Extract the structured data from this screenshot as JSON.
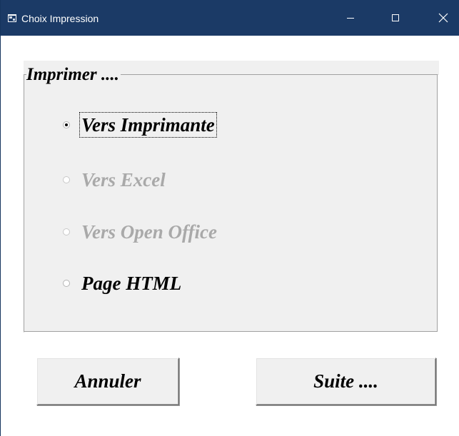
{
  "window": {
    "title": "Choix Impression",
    "icon": "vb-form-icon",
    "controls": {
      "minimize": "minimize-icon",
      "maximize": "maximize-icon",
      "close": "close-icon"
    }
  },
  "frame": {
    "caption": "Imprimer ...."
  },
  "options": [
    {
      "label": "Vers Imprimante",
      "checked": true,
      "enabled": true,
      "focused": true
    },
    {
      "label": "Vers Excel",
      "checked": false,
      "enabled": false,
      "focused": false
    },
    {
      "label": "Vers Open Office",
      "checked": false,
      "enabled": false,
      "focused": false
    },
    {
      "label": "Page HTML",
      "checked": false,
      "enabled": true,
      "focused": false
    }
  ],
  "buttons": {
    "cancel_label": "Annuler",
    "next_label": "Suite ...."
  },
  "colors": {
    "titlebar": "#1b3a66",
    "frame_bg": "#f0f0f0",
    "disabled_text": "#a9a9a9"
  }
}
